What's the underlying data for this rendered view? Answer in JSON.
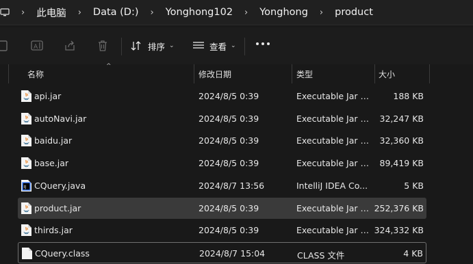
{
  "breadcrumb": [
    "此电脑",
    "Data (D:)",
    "Yonghong102",
    "Yonghong",
    "product"
  ],
  "toolbar": {
    "sort_label": "排序",
    "view_label": "查看"
  },
  "columns": {
    "name": "名称",
    "modified": "修改日期",
    "type": "类型",
    "size": "大小"
  },
  "files": [
    {
      "name": "api.jar",
      "modified": "2024/8/5 0:39",
      "type": "Executable Jar File",
      "size": "188 KB",
      "icon": "jar-file-icon"
    },
    {
      "name": "autoNavi.jar",
      "modified": "2024/8/5 0:39",
      "type": "Executable Jar File",
      "size": "32,247 KB",
      "icon": "jar-file-icon"
    },
    {
      "name": "baidu.jar",
      "modified": "2024/8/5 0:39",
      "type": "Executable Jar File",
      "size": "32,360 KB",
      "icon": "jar-file-icon"
    },
    {
      "name": "base.jar",
      "modified": "2024/8/5 0:39",
      "type": "Executable Jar File",
      "size": "89,419 KB",
      "icon": "jar-file-icon"
    },
    {
      "name": "CQuery.java",
      "modified": "2024/8/7 13:56",
      "type": "IntelliJ IDEA Co...",
      "size": "5 KB",
      "icon": "intellij-java-icon"
    },
    {
      "name": "product.jar",
      "modified": "2024/8/5 0:39",
      "type": "Executable Jar File",
      "size": "252,376 KB",
      "icon": "jar-file-icon",
      "selected": true
    },
    {
      "name": "thirds.jar",
      "modified": "2024/8/5 0:39",
      "type": "Executable Jar File",
      "size": "324,332 KB",
      "icon": "jar-file-icon"
    },
    {
      "name": "CQuery.class",
      "modified": "2024/8/7 15:04",
      "type": "CLASS 文件",
      "size": "4 KB",
      "icon": "blank-file-icon",
      "focused": true
    }
  ],
  "colors": {
    "background": "#191919",
    "toolbar": "#1c1c1c",
    "selected_row": "#3a3a3a",
    "accent_intellij": "#3d7dff"
  }
}
